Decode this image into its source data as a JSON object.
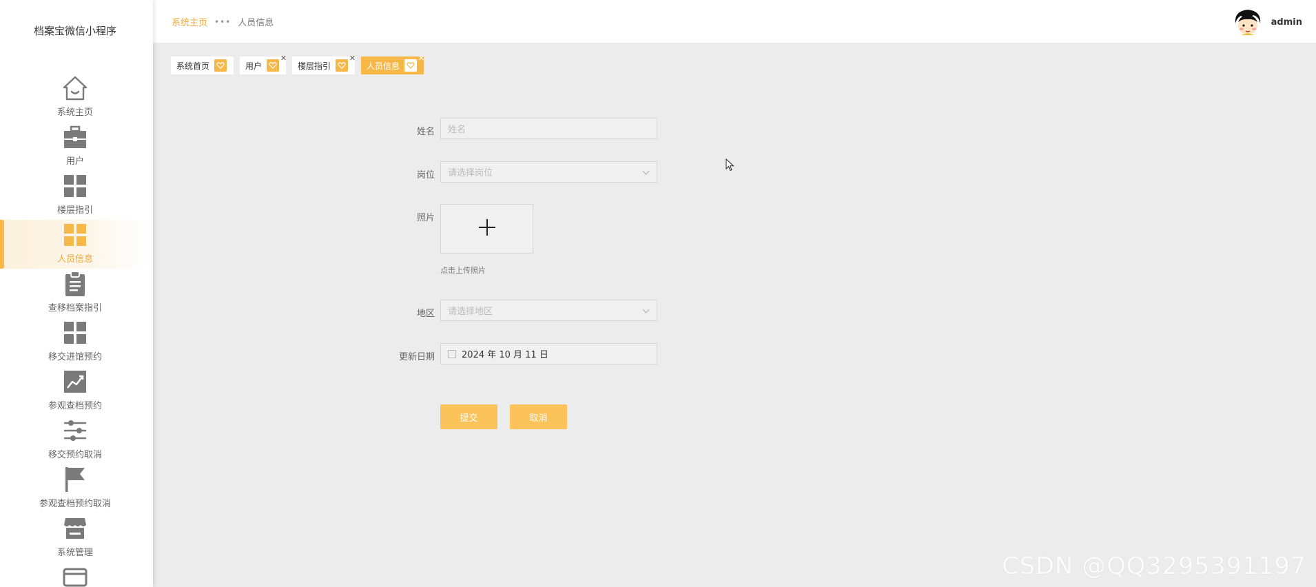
{
  "app": {
    "title": "档案宝微信小程序"
  },
  "sidebar": {
    "items": [
      {
        "label": "系统主页",
        "icon": "home-icon"
      },
      {
        "label": "用户",
        "icon": "briefcase-icon"
      },
      {
        "label": "楼层指引",
        "icon": "grid-icon"
      },
      {
        "label": "人员信息",
        "icon": "grid-icon",
        "active": true
      },
      {
        "label": "查移档案指引",
        "icon": "clipboard-icon"
      },
      {
        "label": "移交进馆预约",
        "icon": "grid-icon"
      },
      {
        "label": "参观查档预约",
        "icon": "chart-icon"
      },
      {
        "label": "移交预约取消",
        "icon": "sliders-icon"
      },
      {
        "label": "参观查档预约取消",
        "icon": "flag-icon"
      },
      {
        "label": "系统管理",
        "icon": "store-icon"
      }
    ]
  },
  "header": {
    "breadcrumb": {
      "home": "系统主页",
      "separator": "•••",
      "current": "人员信息"
    },
    "user": {
      "name": "admin"
    }
  },
  "tags": [
    {
      "label": "系统首页",
      "closable": false,
      "active": false
    },
    {
      "label": "用户",
      "closable": true,
      "active": false
    },
    {
      "label": "楼层指引",
      "closable": true,
      "active": false
    },
    {
      "label": "人员信息",
      "closable": true,
      "active": true
    }
  ],
  "form": {
    "name_label": "姓名",
    "name_placeholder": "姓名",
    "position_label": "岗位",
    "position_placeholder": "请选择岗位",
    "photo_label": "照片",
    "photo_hint": "点击上传照片",
    "region_label": "地区",
    "region_placeholder": "请选择地区",
    "date_label": "更新日期",
    "date_value": "2024 年 10 月 11 日",
    "submit_label": "提交",
    "cancel_label": "取消"
  },
  "watermark": "CSDN @QQ3295391197",
  "colors": {
    "accent": "#f7b84a",
    "button": "#fbc35a",
    "icon": "#7a7a7a",
    "background": "#ececec"
  }
}
